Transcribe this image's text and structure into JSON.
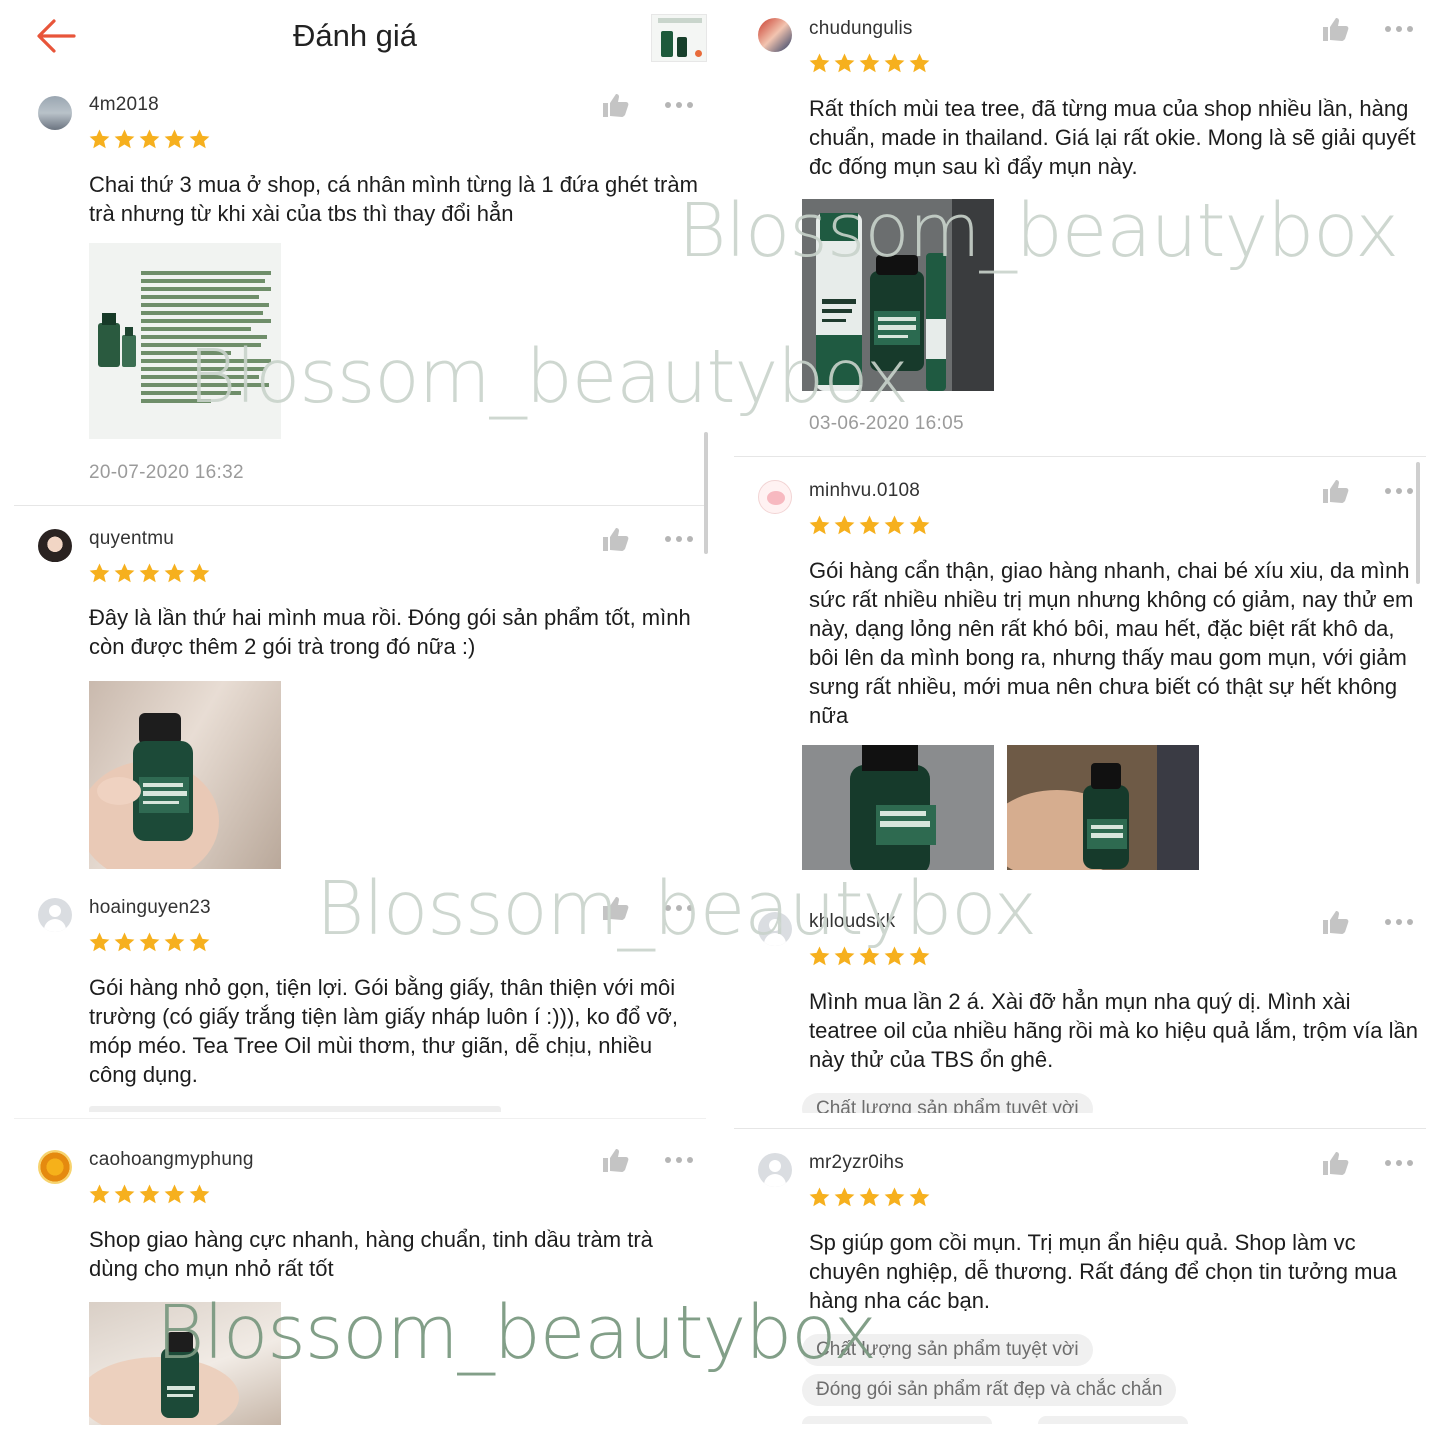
{
  "header": {
    "title": "Đánh giá",
    "back_icon": "arrow-left-icon",
    "accent_color": "#e8553a"
  },
  "star_color": "#f6b01e",
  "left_reviews": [
    {
      "username": "4m2018",
      "stars": 5,
      "text": "Chai thứ 3 mua ở shop, cá nhân mình từng là 1 đứa ghét tràm trà nhưng từ khi xài của tbs thì thay đổi hẳn",
      "timestamp": "20-07-2020 16:32"
    },
    {
      "username": "quyentmu",
      "stars": 5,
      "text": "Đây là lần thứ hai mình mua rồi. Đóng gói sản phẩm tốt, mình còn được thêm 2 gói trà trong đó nữa :)"
    },
    {
      "username": "hoainguyen23",
      "stars": 5,
      "text": "Gói hàng nhỏ gọn, tiện lợi. Gói bằng giấy, thân thiện với môi trường (có giấy trắng tiện làm giấy nháp luôn í :))), ko đổ vỡ, móp méo. Tea Tree Oil mùi thơm, thư giãn, dễ chịu, nhiều công dụng."
    },
    {
      "username": "caohoangmyphung",
      "stars": 5,
      "text": "Shop giao hàng cực nhanh, hàng chuẩn, tinh dầu tràm trà dùng cho mụn nhỏ rất tốt"
    }
  ],
  "right_reviews": [
    {
      "username": "chudungulis",
      "stars": 5,
      "text": "Rất thích mùi tea tree, đã từng mua của shop nhiều lần, hàng chuẩn, made in thailand. Giá lại rất okie. Mong là sẽ giải quyết đc đống mụn sau kì đẩy mụn này.",
      "timestamp": "03-06-2020 16:05"
    },
    {
      "username": "minhvu.0108",
      "stars": 5,
      "text": "Gói hàng cẩn thận, giao hàng nhanh, chai bé xíu xiu, da mình sức rất nhiều nhiều trị mụn nhưng không có giảm, nay thử em này, dạng lỏng nên rất khó bôi, mau hết, đặc biệt rất khô da, bôi lên da mình bong ra, nhưng thấy mau gom mụn, với giảm sưng rất nhiều, mới mua nên chưa biết có thật sự hết không nữa"
    },
    {
      "username": "khloudskk",
      "stars": 5,
      "text": "Mình mua lần 2 á. Xài đỡ hẳn mụn nha quý dị. Mình xài teatree oil của nhiều hãng rồi mà ko hiệu quả lắm, trộm vía lần này thử của TBS ổn ghê.",
      "tags": [
        "Chất lượng sản phẩm tuyệt vời"
      ]
    },
    {
      "username": "mr2yzr0ihs",
      "stars": 5,
      "text": "Sp giúp gom cồi mụn. Trị mụn ẩn hiệu quả. Shop làm vc chuyên nghiệp, dễ thương. Rất đáng để  chọn tin tưởng mua hàng nha các bạn.",
      "tags": [
        "Chất lượng sản phẩm tuyệt vời",
        "Đóng gói sản phẩm rất đẹp và chắc chắn"
      ]
    }
  ],
  "watermark": {
    "text_top": "Blossom_beautybox",
    "text_mid": "Blossom_beautybox",
    "text_center": "Blossom_beautybox",
    "text_bottom": "Blossom_beautybox",
    "color_light": "#c9d3cb",
    "color_dark": "#7c9a82"
  }
}
